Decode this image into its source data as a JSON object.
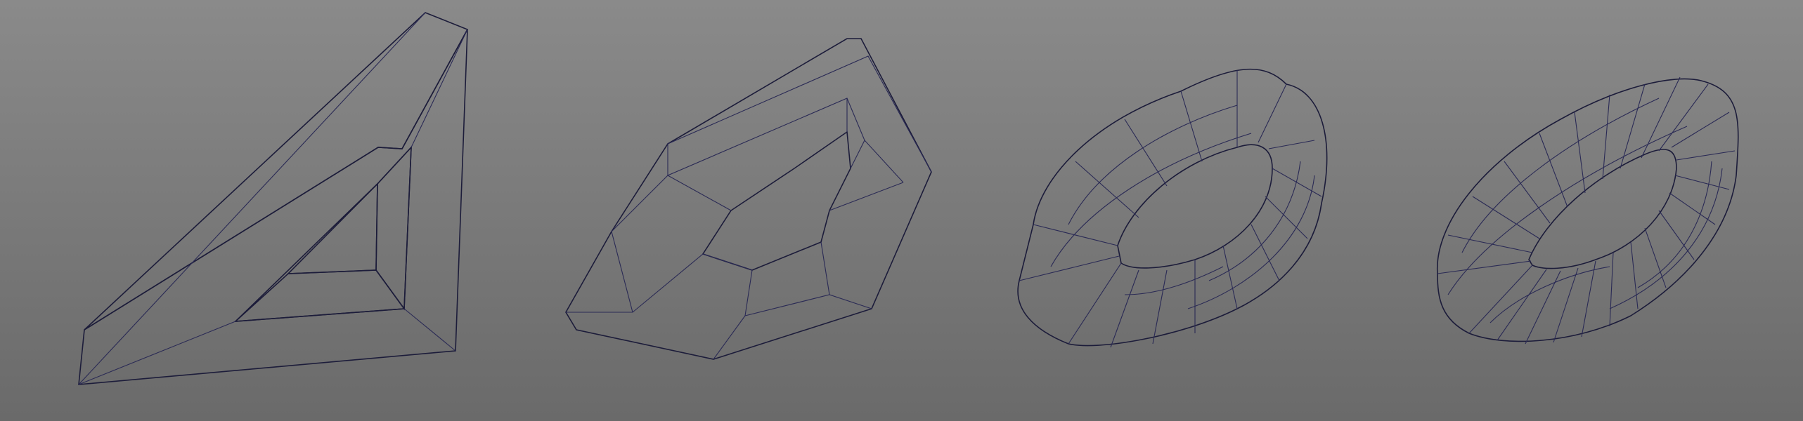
{
  "scene": {
    "description_visible_text": "",
    "models": [
      {
        "id": "triangular-frame",
        "subdivision_level": 0,
        "color": "#8c8ee0"
      },
      {
        "id": "torus-subdiv-1",
        "subdivision_level": 1,
        "color": "#9194ec"
      },
      {
        "id": "torus-subdiv-2",
        "subdivision_level": 2,
        "color": "#9194ec"
      },
      {
        "id": "torus-subdiv-3",
        "subdivision_level": 3,
        "color": "#9194ec"
      }
    ],
    "background_color": "#7c7c7c",
    "wire_color": "#2a2a55"
  }
}
